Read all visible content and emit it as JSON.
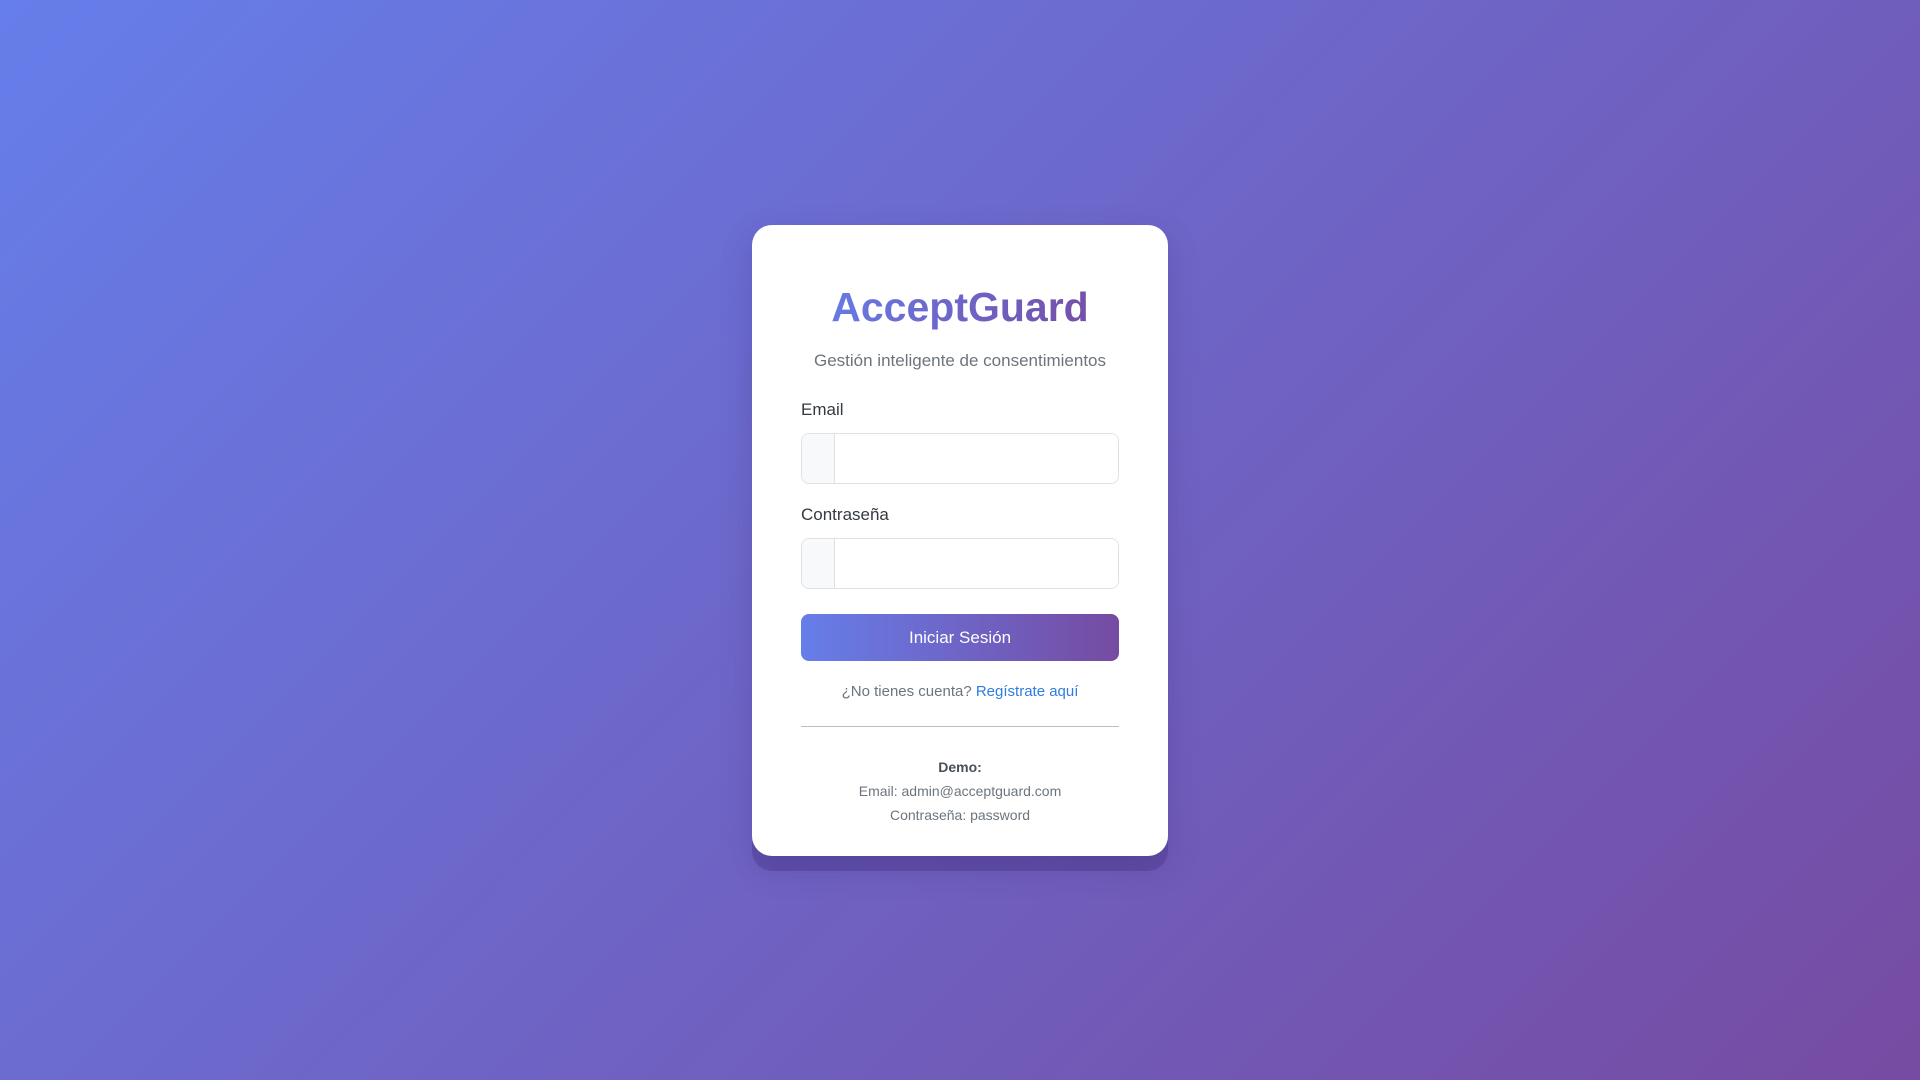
{
  "brand": {
    "name": "AcceptGuard",
    "tagline": "Gestión inteligente de consentimientos"
  },
  "form": {
    "email_label": "Email",
    "email_value": "",
    "email_placeholder": "",
    "password_label": "Contraseña",
    "password_value": "",
    "password_placeholder": "",
    "submit_label": "Iniciar Sesión"
  },
  "register": {
    "prompt": "¿No tienes cuenta?",
    "link_label": "Regístrate aquí"
  },
  "demo": {
    "title": "Demo:",
    "email_line": "Email: admin@acceptguard.com",
    "password_line": "Contraseña: password"
  },
  "colors": {
    "gradient_start": "#667eea",
    "gradient_end": "#764ba2",
    "link": "#2f7de1"
  }
}
